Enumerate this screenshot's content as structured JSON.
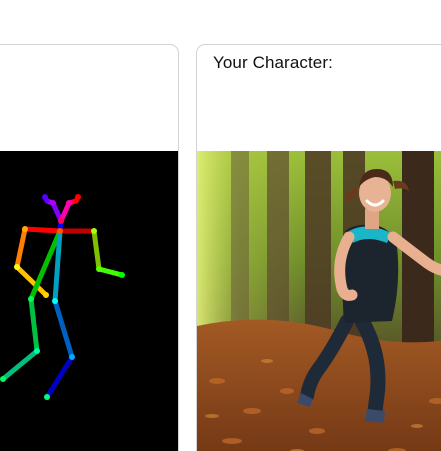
{
  "panels": {
    "pose": {
      "title": "",
      "image_icon": "pose-skeleton-image"
    },
    "character": {
      "title": "Your Character:",
      "image_icon": "running-woman-forest-photo"
    }
  },
  "colors": {
    "card_border": "#d3d3d3",
    "pose_background": "#000000",
    "title_text": "#111111"
  }
}
